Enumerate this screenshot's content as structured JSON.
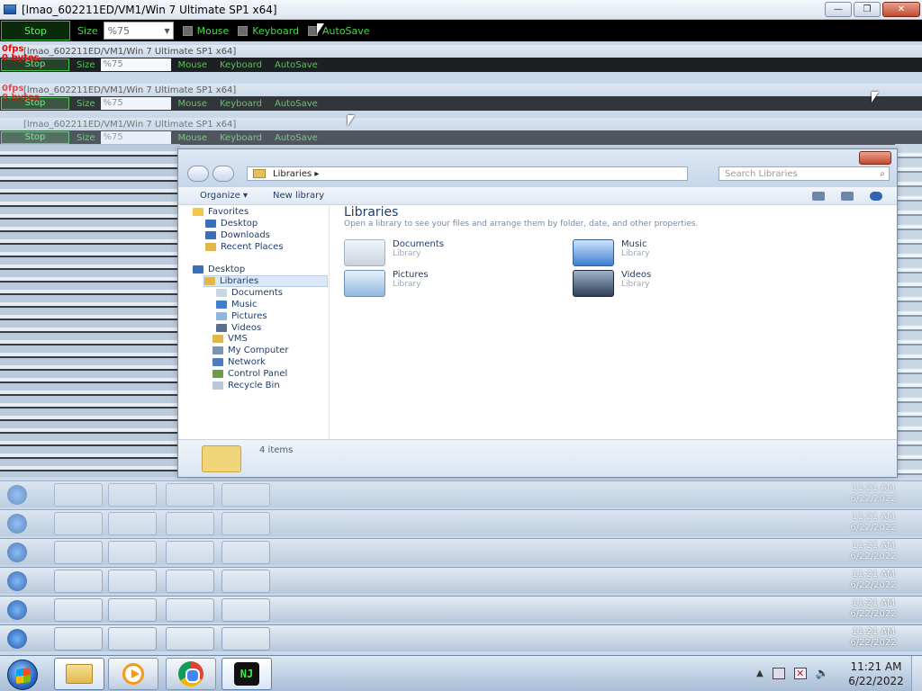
{
  "window": {
    "title": "[lmao_602211ED/VM1/Win 7 Ultimate SP1 x64]",
    "min_glyph": "—",
    "max_glyph": "❐",
    "close_glyph": "✕"
  },
  "toolbar": {
    "stop_label": "Stop",
    "size_label": "Size",
    "size_value": "%75",
    "mouse_label": "Mouse",
    "keyboard_label": "Keyboard",
    "autosave_label": "AutoSave"
  },
  "overlay": {
    "fps_line1": "0fps",
    "fps_line2": "0 bytes"
  },
  "explorer": {
    "address": "Libraries ▸",
    "search_placeholder": "Search Libraries",
    "organize": "Organize ▾",
    "new_library": "New library",
    "nav": [
      "Favorites",
      "Desktop",
      "Downloads",
      "Recent Places",
      "Desktop",
      "Libraries",
      "Documents",
      "Music",
      "Pictures",
      "Videos",
      "VMS",
      "My Computer",
      "Network",
      "Control Panel",
      "Recycle Bin"
    ],
    "content_title": "Libraries",
    "content_sub": "Open a library to see your files and arrange them by folder, date, and other properties.",
    "libraries": [
      {
        "name": "Documents",
        "kind": "Library"
      },
      {
        "name": "Music",
        "kind": "Library"
      },
      {
        "name": "Pictures",
        "kind": "Library"
      },
      {
        "name": "Videos",
        "kind": "Library"
      }
    ],
    "status": "4 items"
  },
  "taskbar": {
    "time": "11:21 AM",
    "date": "6/22/2022",
    "nj_label": "NJ"
  },
  "colors": {
    "accent_green": "#44d944",
    "fps_red": "#e01010"
  }
}
